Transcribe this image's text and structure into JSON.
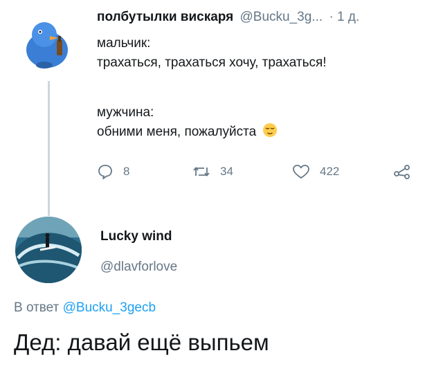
{
  "tweet": {
    "author_name": "полбутылки вискаря",
    "author_handle": "@Bucku_3g...",
    "time": "· 1 д.",
    "line1": "мальчик:",
    "line2": "трахаться, трахаться хочу, трахаться!",
    "line3": "мужчина:",
    "line4": "обними меня, пожалуйста",
    "emoji_icon": "relieved-face-emoji",
    "replies": "8",
    "retweets": "34",
    "likes": "422"
  },
  "reply": {
    "author_name": "Lucky wind",
    "author_handle": "@dlavforlove",
    "reply_to_prefix": "В ответ",
    "reply_to_handle": "@Bucku_3gecb",
    "text": "Дед: давай ещё выпьем"
  },
  "colors": {
    "accent": "#1da1f2",
    "muted": "#657786",
    "line": "#ccd6dd"
  }
}
